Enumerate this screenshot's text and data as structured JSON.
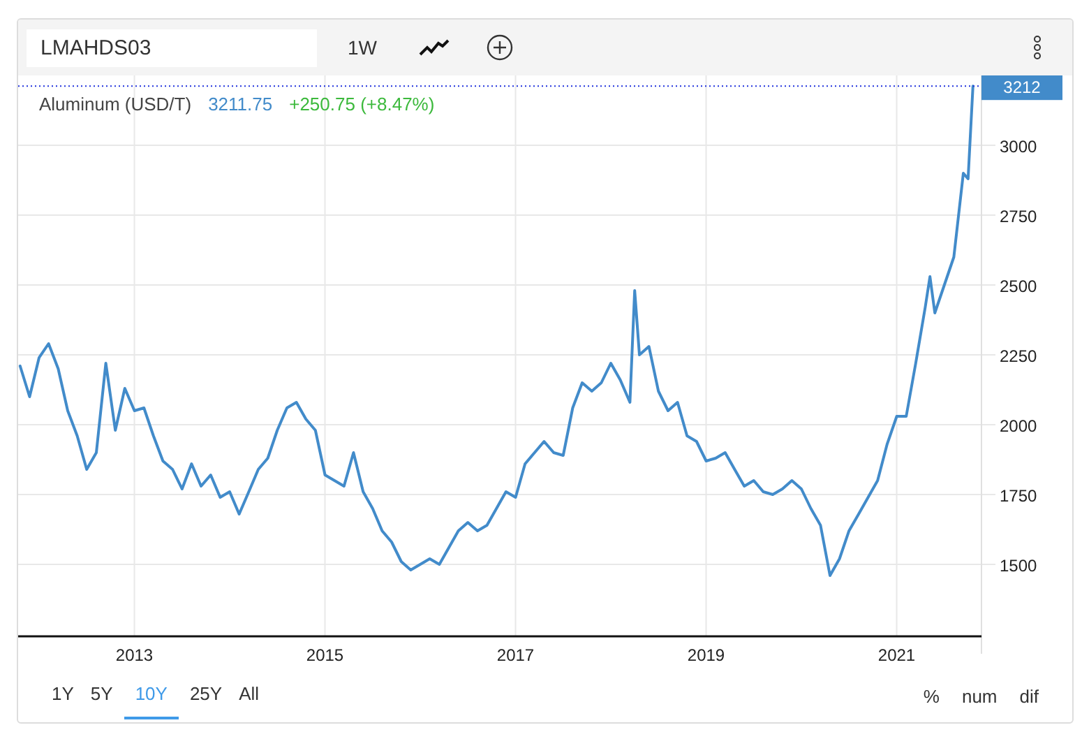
{
  "toolbar": {
    "symbol": "LMAHDS03",
    "interval": "1W"
  },
  "legend": {
    "name": "Aluminum (USD/T)",
    "price": "3211.75",
    "change": "+250.75 (+8.47%)"
  },
  "chart_data": {
    "type": "line",
    "grid": true,
    "ref_lines": [
      {
        "axis": "y",
        "value": 3212,
        "label": "3212",
        "color": "#2233dd"
      }
    ],
    "x": [
      2011.8,
      2011.9,
      2012.0,
      2012.1,
      2012.2,
      2012.3,
      2012.4,
      2012.5,
      2012.6,
      2012.7,
      2012.8,
      2012.9,
      2013.0,
      2013.1,
      2013.2,
      2013.3,
      2013.4,
      2013.5,
      2013.6,
      2013.7,
      2013.8,
      2013.9,
      2014.0,
      2014.1,
      2014.2,
      2014.3,
      2014.4,
      2014.5,
      2014.6,
      2014.7,
      2014.8,
      2014.9,
      2015.0,
      2015.1,
      2015.2,
      2015.3,
      2015.4,
      2015.5,
      2015.6,
      2015.7,
      2015.8,
      2015.9,
      2016.0,
      2016.1,
      2016.2,
      2016.3,
      2016.4,
      2016.5,
      2016.6,
      2016.7,
      2016.8,
      2016.9,
      2017.0,
      2017.1,
      2017.2,
      2017.3,
      2017.4,
      2017.5,
      2017.6,
      2017.7,
      2017.8,
      2017.9,
      2018.0,
      2018.1,
      2018.2,
      2018.25,
      2018.3,
      2018.4,
      2018.5,
      2018.6,
      2018.7,
      2018.8,
      2018.9,
      2019.0,
      2019.1,
      2019.2,
      2019.3,
      2019.4,
      2019.5,
      2019.6,
      2019.7,
      2019.8,
      2019.9,
      2020.0,
      2020.1,
      2020.2,
      2020.3,
      2020.4,
      2020.5,
      2020.6,
      2020.7,
      2020.8,
      2020.9,
      2021.0,
      2021.1,
      2021.2,
      2021.3,
      2021.35,
      2021.4,
      2021.5,
      2021.6,
      2021.7,
      2021.75,
      2021.8
    ],
    "series": [
      {
        "color": "#428bca",
        "values": [
          2210,
          2100,
          2240,
          2290,
          2200,
          2050,
          1960,
          1840,
          1900,
          2220,
          1980,
          2130,
          2050,
          2060,
          1960,
          1870,
          1840,
          1770,
          1860,
          1780,
          1820,
          1740,
          1760,
          1680,
          1760,
          1840,
          1880,
          1980,
          2060,
          2080,
          2020,
          1980,
          1820,
          1800,
          1780,
          1900,
          1760,
          1700,
          1620,
          1580,
          1510,
          1480,
          1500,
          1520,
          1500,
          1560,
          1620,
          1650,
          1620,
          1640,
          1700,
          1760,
          1740,
          1860,
          1900,
          1940,
          1900,
          1890,
          2060,
          2150,
          2120,
          2150,
          2220,
          2160,
          2080,
          2480,
          2250,
          2280,
          2120,
          2050,
          2080,
          1960,
          1940,
          1870,
          1880,
          1900,
          1840,
          1780,
          1800,
          1760,
          1750,
          1770,
          1800,
          1770,
          1700,
          1640,
          1460,
          1520,
          1620,
          1680,
          1740,
          1800,
          1930,
          2030,
          2030,
          2220,
          2420,
          2530,
          2400,
          2500,
          2600,
          2900,
          2880,
          3212
        ]
      }
    ],
    "xlim": [
      2011.78,
      2021.89
    ],
    "ylim": [
      1245,
      3250
    ],
    "xticks": [
      {
        "value": 2013,
        "label": "2013"
      },
      {
        "value": 2015,
        "label": "2015"
      },
      {
        "value": 2017,
        "label": "2017"
      },
      {
        "value": 2019,
        "label": "2019"
      },
      {
        "value": 2021,
        "label": "2021"
      }
    ],
    "yticks": [
      1500,
      1750,
      2000,
      2250,
      2500,
      2750,
      3000
    ]
  },
  "ranges": [
    {
      "label": "1Y",
      "selected": false
    },
    {
      "label": "5Y",
      "selected": false
    },
    {
      "label": "10Y",
      "selected": true
    },
    {
      "label": "25Y",
      "selected": false
    },
    {
      "label": "All",
      "selected": false
    }
  ],
  "modes": [
    "%",
    "num",
    "dif"
  ]
}
